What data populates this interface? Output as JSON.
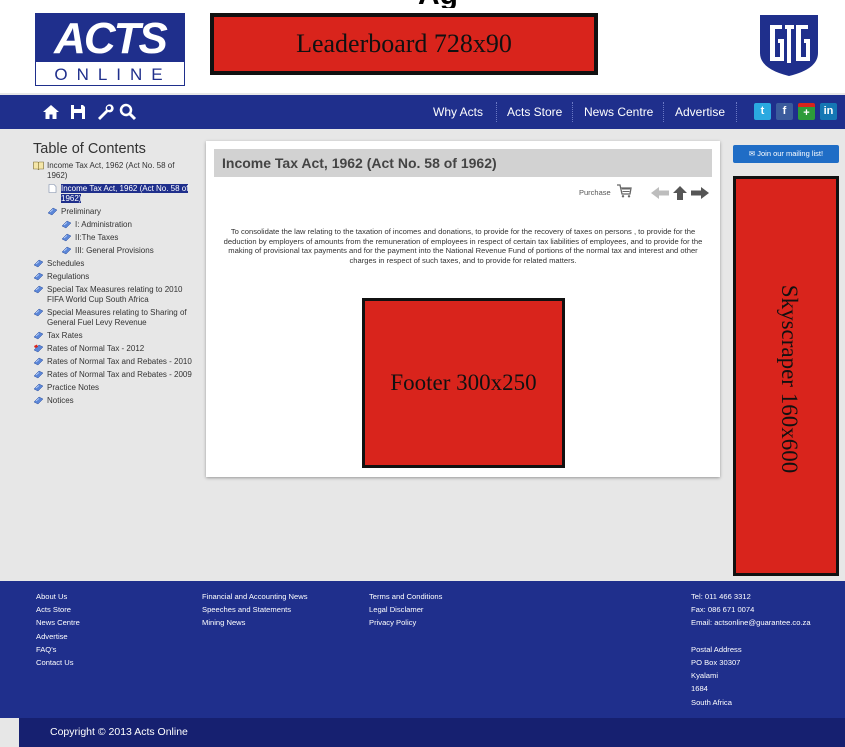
{
  "header": {
    "partial_text": "Ag",
    "logo_top": "ACTS",
    "logo_bottom": "ONLINE",
    "leaderboard_label": "Leaderboard 728x90"
  },
  "nav": {
    "icons": [
      "home-icon",
      "save-icon",
      "tools-icon",
      "search-icon"
    ],
    "links": [
      "Why Acts",
      "Acts Store",
      "News Centre",
      "Advertise"
    ],
    "social": [
      "twitter-icon",
      "facebook-icon",
      "google-plus-icon",
      "linkedin-icon"
    ]
  },
  "toc": {
    "title": "Table of Contents",
    "items": [
      {
        "label": "Income Tax Act, 1962 (Act No. 58 of 1962)",
        "icon": "book-icon"
      },
      {
        "label": "Income Tax Act, 1962 (Act No. 58 of 1962)",
        "icon": "page-icon",
        "selected": true
      },
      {
        "label": "Preliminary",
        "icon": "diamond-icon"
      },
      {
        "label": "I: Administration",
        "icon": "diamond-icon"
      },
      {
        "label": "II:The Taxes",
        "icon": "diamond-icon"
      },
      {
        "label": "III: General Provisions",
        "icon": "diamond-icon"
      },
      {
        "label": "Schedules",
        "icon": "diamond-icon"
      },
      {
        "label": "Regulations",
        "icon": "diamond-icon"
      },
      {
        "label": "Special Tax Measures relating to 2010 FIFA World Cup South Africa",
        "icon": "diamond-icon"
      },
      {
        "label": "Special Measures relating to Sharing of General Fuel Levy Revenue",
        "icon": "diamond-icon"
      },
      {
        "label": "Tax Rates",
        "icon": "diamond-icon"
      },
      {
        "label": "Rates of Normal Tax - 2012",
        "icon": "diamond-red-icon"
      },
      {
        "label": "Rates of Normal Tax and Rebates - 2010",
        "icon": "diamond-icon"
      },
      {
        "label": "Rates of Normal Tax and Rebates - 2009",
        "icon": "diamond-icon"
      },
      {
        "label": "Practice Notes",
        "icon": "diamond-icon"
      },
      {
        "label": "Notices",
        "icon": "diamond-icon"
      }
    ]
  },
  "main": {
    "title": "Income Tax Act, 1962 (Act No. 58 of 1962)",
    "purchase_label": "Purchase",
    "description": "To consolidate the law relating to the taxation of incomes and donations, to provide for the recovery of taxes on persons , to provide for the deduction by employers of amounts from the remuneration of employees in respect of certain tax liabilities of employees, and to provide for the making of provisional tax payments and for the payment into the National Revenue Fund of portions of the normal tax and interest and other charges in respect of such taxes, and to provide for related matters.",
    "footer_ad_label": "Footer 300x250"
  },
  "right": {
    "mailing_label": "✉ Join our mailing list!",
    "skyscraper_label": "Skyscraper 160x600"
  },
  "footer": {
    "col1": [
      "About Us",
      "Acts Store",
      "News Centre",
      "Advertise",
      "FAQ's",
      "Contact Us"
    ],
    "col2": [
      "Financial and Accounting News",
      "Speeches and Statements",
      "Mining News"
    ],
    "col3": [
      "Terms and Conditions",
      "Legal Disclamer",
      "Privacy Policy"
    ],
    "contact": [
      "Tel: 011 466 3312",
      "Fax: 086 671 0074",
      "Email: actsonline@guarantee.co.za"
    ],
    "postal": [
      "Postal Address",
      "PO Box 30307",
      "Kyalami",
      "1684",
      "South Africa"
    ],
    "copyright": "Copyright © 2013 Acts Online"
  },
  "colors": {
    "brand_blue": "#1f2f8c",
    "ad_red": "#d9241c",
    "mailing_blue": "#1f6dc6"
  }
}
